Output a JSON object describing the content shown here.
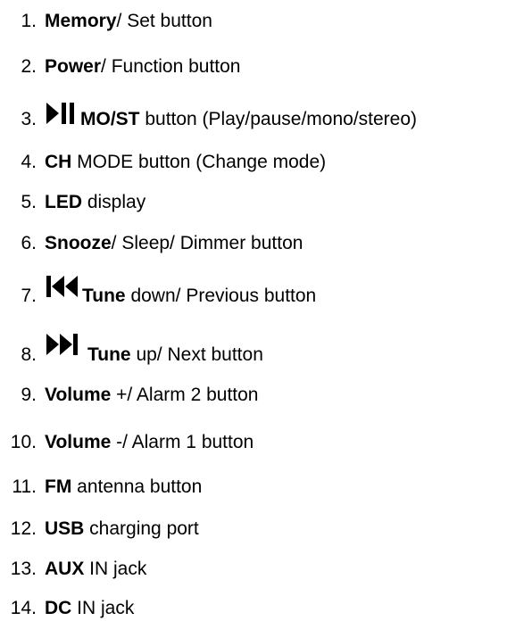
{
  "items": [
    {
      "num": "1.",
      "bold": "Memory",
      "rest": "/ Set button"
    },
    {
      "num": "2.",
      "bold": "Power",
      "rest": "/ Function button"
    },
    {
      "num": "3.",
      "icon": "play-pause-icon",
      "bold": "MO/ST",
      "rest": " button (Play/pause/mono/stereo)"
    },
    {
      "num": "4.",
      "bold": "CH",
      "rest": " MODE button (Change mode)"
    },
    {
      "num": "5.",
      "bold": "LED",
      "rest": " display"
    },
    {
      "num": "6.",
      "bold": "Snooze",
      "rest": "/ Sleep/ Dimmer button"
    },
    {
      "num": "7.",
      "icon": "skip-previous-icon",
      "bold": "Tune",
      "rest": " down/ Previous button"
    },
    {
      "num": "8.",
      "icon": "skip-next-icon",
      "bold": "Tune",
      "rest": " up/ Next button"
    },
    {
      "num": "9.",
      "bold": "Volume",
      "rest": " +/ Alarm 2 button"
    },
    {
      "num": "10.",
      "bold": "Volume",
      "rest": " -/ Alarm 1 button"
    },
    {
      "num": "11.",
      "bold": "FM",
      "rest": " antenna button"
    },
    {
      "num": "12.",
      "bold": "USB",
      "rest": " charging port"
    },
    {
      "num": "13.",
      "bold": "AUX",
      "rest": " IN jack"
    },
    {
      "num": "14.",
      "bold": "DC",
      "rest": " IN jack"
    }
  ]
}
